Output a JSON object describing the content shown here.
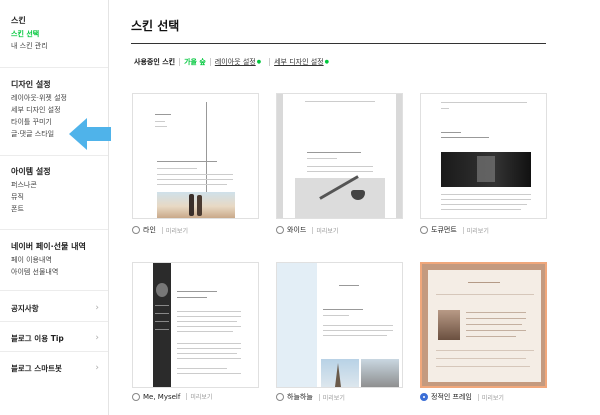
{
  "sidebar": {
    "skin": {
      "heading": "스킨",
      "items": [
        "스킨 선택",
        "내 스킨 관리"
      ]
    },
    "design": {
      "heading": "디자인 설정",
      "items": [
        "레이아웃·위젯 설정",
        "세부 디자인 설정",
        "타이틀 꾸미기",
        "글·댓글 스타일"
      ]
    },
    "item": {
      "heading": "아이템 설정",
      "items": [
        "퍼스나콘",
        "뮤직",
        "폰트"
      ]
    },
    "pay": {
      "heading": "네이버 페이·선물 내역",
      "items": [
        "페이 이용내역",
        "아이템 선물내역"
      ]
    },
    "menus": [
      "공지사항",
      "블로그 이용 Tip",
      "블로그 스마트봇"
    ]
  },
  "main": {
    "title": "스킨 선택",
    "tabs": {
      "current": "사용중인 스킨",
      "current_name": "가을 숲",
      "layout": "레이아웃 설정",
      "detail": "세부 디자인 설정"
    },
    "preview_label": "미리보기",
    "skins": [
      {
        "name": "라인",
        "selected": false
      },
      {
        "name": "와이드",
        "selected": false
      },
      {
        "name": "도큐먼트",
        "selected": false
      },
      {
        "name": "Me, Myself",
        "selected": false
      },
      {
        "name": "하늘하늘",
        "selected": false
      },
      {
        "name": "정적인 프레임",
        "selected": true
      }
    ]
  },
  "colors": {
    "accent": "#00c73c",
    "arrow": "#4fb3ea",
    "selected_border": "#f0a77b",
    "radio_on": "#3b6ed6"
  },
  "icons": [
    "chevron-right-icon",
    "arrow-pointer-icon"
  ]
}
